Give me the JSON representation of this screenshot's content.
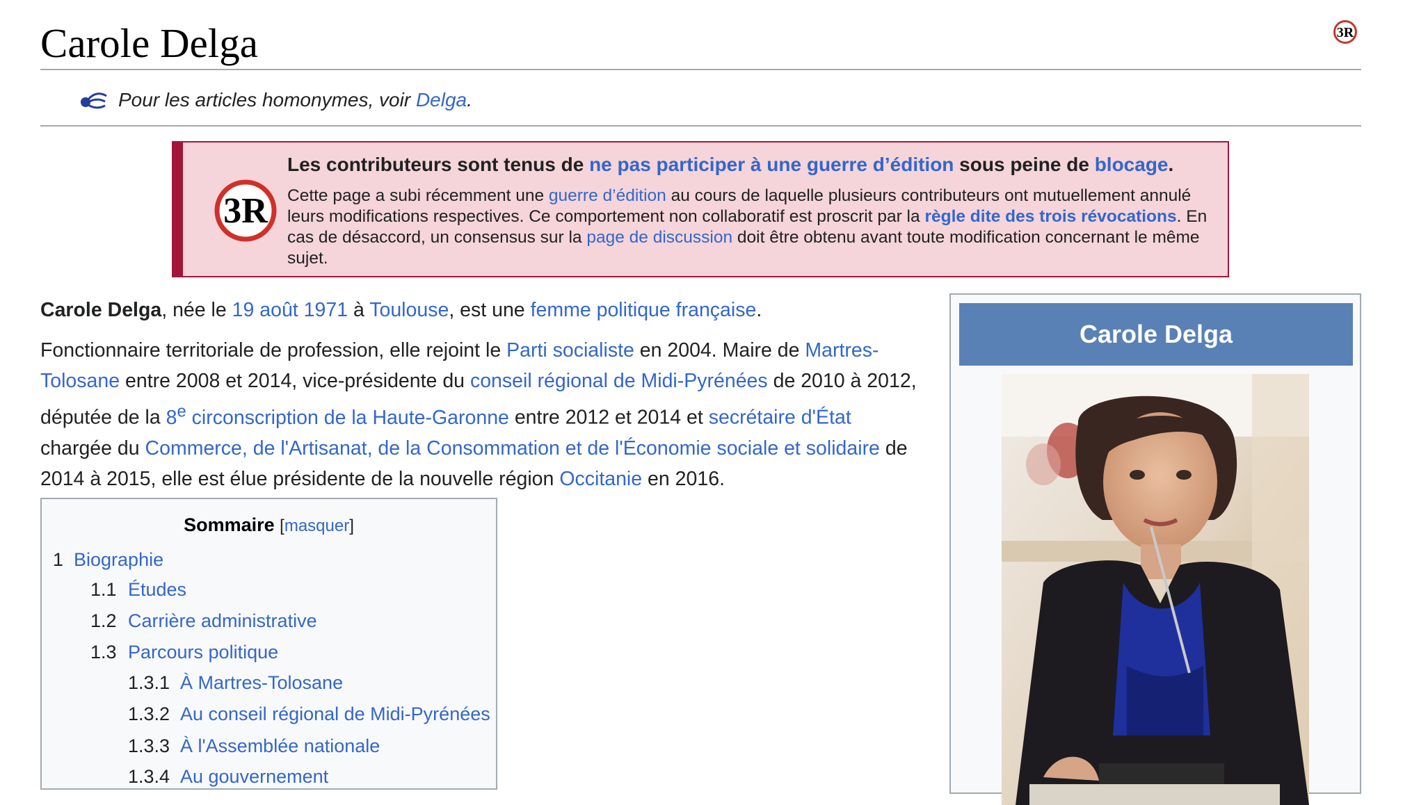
{
  "page": {
    "title": "Carole Delga"
  },
  "hatnote": {
    "prefix": "Pour les articles homonymes, voir ",
    "link": "Delga",
    "suffix": "."
  },
  "banner": {
    "head_prefix": "Les contributeurs sont tenus de ",
    "head_link1": "ne pas participer à une guerre d’édition",
    "head_mid": " sous peine de ",
    "head_link2": "blocage",
    "head_suffix": ".",
    "body_1": "Cette page a subi récemment une ",
    "body_link1": "guerre d’édition",
    "body_2": " au cours de laquelle plusieurs contributeurs ont mutuellement annulé leurs modifications respectives. Ce comportement non collaboratif est proscrit par la ",
    "body_link2": "règle dite des trois révocations",
    "body_3": ". En cas de désaccord, un consensus sur la ",
    "body_link3": "page de discussion",
    "body_4": " doit être obtenu avant toute modification concernant le même sujet.",
    "icon_letters": "3R"
  },
  "lead": {
    "p1_bold": "Carole Delga",
    "p1_a": ", née le ",
    "p1_link_date": "19 août 1971",
    "p1_b": " à ",
    "p1_link_city": "Toulouse",
    "p1_c": ", est une ",
    "p1_link_role": "femme politique française",
    "p1_d": ".",
    "p2_a": "Fonctionnaire territoriale de profession, elle rejoint le ",
    "p2_link_ps": "Parti socialiste",
    "p2_b": " en 2004. Maire de ",
    "p2_link_mt": "Martres-Tolosane",
    "p2_c": " entre 2008 et 2014, vice-présidente du ",
    "p2_link_cr": "conseil régional de Midi-Pyrénées",
    "p2_d": " de 2010 à 2012, députée de la ",
    "p2_link_circ_num": "8",
    "p2_link_circ_sup": "e",
    "p2_link_circ": " circonscription de la Haute-Garonne",
    "p2_e": " entre 2012 et 2014 et ",
    "p2_link_se": "secrétaire d'État",
    "p2_f": " chargée du ",
    "p2_link_min": "Commerce, de l'Artisanat, de la Consommation et de l'Économie sociale et solidaire",
    "p2_g": " de 2014 à 2015, elle est élue présidente de la nouvelle région ",
    "p2_link_occ": "Occitanie",
    "p2_h": " en 2016."
  },
  "toc": {
    "title": "Sommaire",
    "toggle_open": "[",
    "toggle": "masquer",
    "toggle_close": "]",
    "items": [
      {
        "num": "1",
        "label": "Biographie"
      },
      {
        "num": "1.1",
        "label": "Études"
      },
      {
        "num": "1.2",
        "label": "Carrière administrative"
      },
      {
        "num": "1.3",
        "label": "Parcours politique"
      },
      {
        "num": "1.3.1",
        "label": "À Martres-Tolosane"
      },
      {
        "num": "1.3.2",
        "label": "Au conseil régional de Midi-Pyrénées"
      },
      {
        "num": "1.3.3",
        "label": "À l'Assemblée nationale"
      },
      {
        "num": "1.3.4",
        "label": "Au gouvernement"
      }
    ]
  },
  "infobox": {
    "title": "Carole Delga"
  },
  "colors": {
    "link": "#3366cc",
    "banner_bg": "#f5d5d9",
    "banner_border": "#a2163a",
    "infobox_header": "#5a81b5"
  }
}
